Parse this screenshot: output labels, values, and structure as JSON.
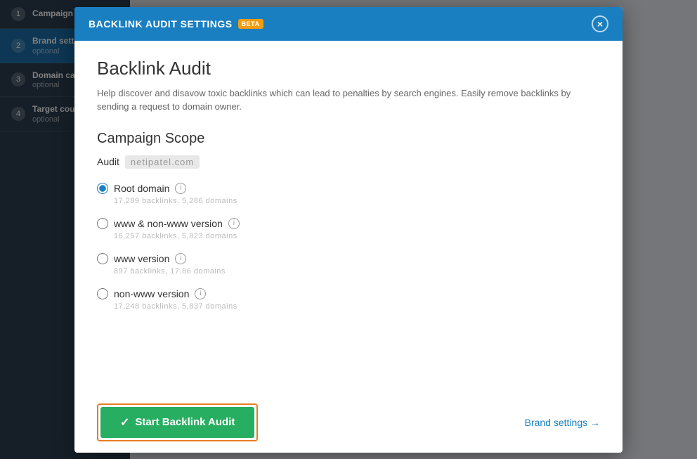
{
  "modal": {
    "header": {
      "title": "BACKLINK AUDIT SETTINGS",
      "beta_badge": "BETA",
      "close_label": "×"
    },
    "body": {
      "title": "Backlink Audit",
      "description": "Help discover and disavow toxic backlinks which can lead to penalties by search engines. Easily remove backlinks by sending a request to domain owner.",
      "section_title": "Campaign Scope",
      "audit_label": "Audit",
      "audit_domain": "netipatel.com",
      "options": [
        {
          "id": "root-domain",
          "label": "Root domain",
          "checked": true,
          "stats": "17,289 backlinks, 5,286 domains"
        },
        {
          "id": "www-nonwww",
          "label": "www & non-www version",
          "checked": false,
          "stats": "16,257 backlinks, 5,823 domains"
        },
        {
          "id": "www-version",
          "label": "www version",
          "checked": false,
          "stats": "897 backlinks, 17.86 domains"
        },
        {
          "id": "nonwww-version",
          "label": "non-www version",
          "checked": false,
          "stats": "17,248 backlinks, 5,837 domains"
        }
      ]
    },
    "footer": {
      "start_button_label": "Start Backlink Audit",
      "brand_settings_link": "Brand settings →"
    }
  },
  "sidebar": {
    "items": [
      {
        "number": "1",
        "label": "Campaign scope",
        "sub": "",
        "active": false
      },
      {
        "number": "2",
        "label": "Brand settings",
        "sub": "optional",
        "active": true
      },
      {
        "number": "3",
        "label": "Domain categories",
        "sub": "optional",
        "active": false
      },
      {
        "number": "4",
        "label": "Target countries",
        "sub": "optional",
        "active": false
      }
    ]
  }
}
